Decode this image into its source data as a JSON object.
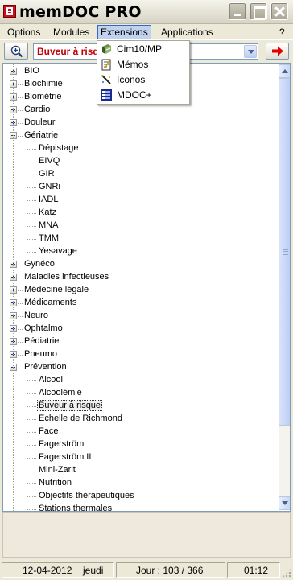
{
  "window": {
    "title": "memDOC PRO"
  },
  "menubar": {
    "items": [
      "Options",
      "Modules",
      "Extensions",
      "Applications",
      "?"
    ],
    "active": "Extensions"
  },
  "toolbar": {
    "combo_value": "Buveur à risque",
    "zoom_icon": "zoom-in-icon",
    "go_icon": "arrow-right-icon",
    "go_color": "#E00000"
  },
  "extensions_menu": [
    {
      "label": "Cim10/MP",
      "icon": "book-icon"
    },
    {
      "label": "Mémos",
      "icon": "notepad-icon"
    },
    {
      "label": "Iconos",
      "icon": "pen-icon"
    },
    {
      "label": "MDOC+",
      "icon": "list-icon"
    }
  ],
  "tree": [
    {
      "label": "BIO",
      "level": 0,
      "state": "collapsed"
    },
    {
      "label": "Biochimie",
      "level": 0,
      "state": "collapsed"
    },
    {
      "label": "Biométrie",
      "level": 0,
      "state": "collapsed"
    },
    {
      "label": "Cardio",
      "level": 0,
      "state": "collapsed"
    },
    {
      "label": "Douleur",
      "level": 0,
      "state": "collapsed"
    },
    {
      "label": "Gériatrie",
      "level": 0,
      "state": "expanded"
    },
    {
      "label": "Dépistage",
      "level": 1
    },
    {
      "label": "EIVQ",
      "level": 1
    },
    {
      "label": "GIR",
      "level": 1
    },
    {
      "label": "GNRi",
      "level": 1
    },
    {
      "label": "IADL",
      "level": 1
    },
    {
      "label": "Katz",
      "level": 1
    },
    {
      "label": "MNA",
      "level": 1
    },
    {
      "label": "TMM",
      "level": 1
    },
    {
      "label": "Yesavage",
      "level": 1,
      "last": true
    },
    {
      "label": "Gynéco",
      "level": 0,
      "state": "collapsed"
    },
    {
      "label": "Maladies infectieuses",
      "level": 0,
      "state": "collapsed"
    },
    {
      "label": "Médecine légale",
      "level": 0,
      "state": "collapsed"
    },
    {
      "label": "Médicaments",
      "level": 0,
      "state": "collapsed"
    },
    {
      "label": "Neuro",
      "level": 0,
      "state": "collapsed"
    },
    {
      "label": "Ophtalmo",
      "level": 0,
      "state": "collapsed"
    },
    {
      "label": "Pédiatrie",
      "level": 0,
      "state": "collapsed"
    },
    {
      "label": "Pneumo",
      "level": 0,
      "state": "collapsed"
    },
    {
      "label": "Prévention",
      "level": 0,
      "state": "expanded"
    },
    {
      "label": "Alcool",
      "level": 1
    },
    {
      "label": "Alcoolémie",
      "level": 1
    },
    {
      "label": "Buveur à risque",
      "level": 1,
      "selected": true
    },
    {
      "label": "Echelle de Richmond",
      "level": 1
    },
    {
      "label": "Face",
      "level": 1
    },
    {
      "label": "Fagerström",
      "level": 1
    },
    {
      "label": "Fagerström II",
      "level": 1
    },
    {
      "label": "Mini-Zarit",
      "level": 1
    },
    {
      "label": "Nutrition",
      "level": 1
    },
    {
      "label": "Objectifs thérapeutiques",
      "level": 1
    },
    {
      "label": "Stations thermales",
      "level": 1
    }
  ],
  "status": {
    "date": "12-04-2012",
    "weekday": "jeudi",
    "day_of_year": "Jour : 103 / 366",
    "time": "01:12"
  }
}
